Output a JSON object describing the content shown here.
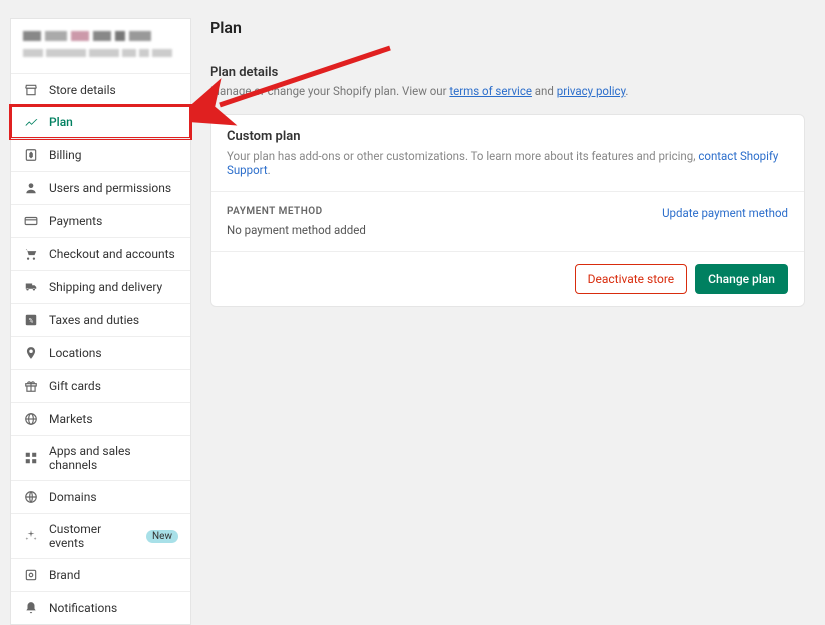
{
  "page": {
    "title": "Plan"
  },
  "section": {
    "title": "Plan details",
    "desc_prefix": "Manage or change your Shopify plan. View our ",
    "tos": "terms of service",
    "and": " and ",
    "pp": "privacy policy",
    "period": "."
  },
  "custom": {
    "title": "Custom plan",
    "desc_prefix": "Your plan has add-ons or other customizations. To learn more about its features and pricing, ",
    "link": "contact Shopify Support",
    "period": "."
  },
  "payment": {
    "label": "PAYMENT METHOD",
    "value": "No payment method added",
    "update": "Update payment method"
  },
  "actions": {
    "deactivate": "Deactivate store",
    "change": "Change plan"
  },
  "sidebar": {
    "items": [
      {
        "label": "Store details"
      },
      {
        "label": "Plan"
      },
      {
        "label": "Billing"
      },
      {
        "label": "Users and permissions"
      },
      {
        "label": "Payments"
      },
      {
        "label": "Checkout and accounts"
      },
      {
        "label": "Shipping and delivery"
      },
      {
        "label": "Taxes and duties"
      },
      {
        "label": "Locations"
      },
      {
        "label": "Gift cards"
      },
      {
        "label": "Markets"
      },
      {
        "label": "Apps and sales channels"
      },
      {
        "label": "Domains"
      },
      {
        "label": "Customer events"
      },
      {
        "label": "Brand"
      },
      {
        "label": "Notifications"
      }
    ]
  },
  "badge": {
    "new": "New"
  }
}
